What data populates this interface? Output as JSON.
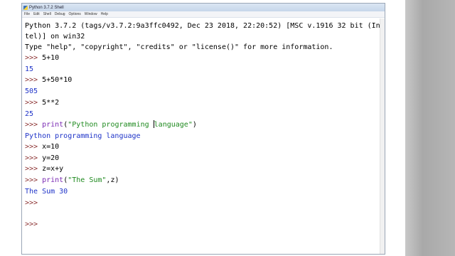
{
  "window": {
    "title": "Python 3.7.2 Shell"
  },
  "menu": [
    "File",
    "Edit",
    "Shell",
    "Debug",
    "Options",
    "Window",
    "Help"
  ],
  "console": {
    "banner1": "Python 3.7.2 (tags/v3.7.2:9a3ffc0492, Dec 23 2018, 22:20:52) [MSC v.1916 32 bit (In",
    "banner2": "tel)] on win32",
    "banner3": "Type \"help\", \"copyright\", \"credits\" or \"license()\" for more information.",
    "prompt": ">>> ",
    "l1_in": "5+10",
    "l1_out": "15",
    "l2_in": "5+50*10",
    "l2_out": "505",
    "l3_in": "5**2",
    "l3_out": "25",
    "l4_kw": "print",
    "l4_open": "(",
    "l4_str_a": "\"Python programming ",
    "l4_str_b": "language\"",
    "l4_close": ")",
    "l4_out": "Python programming language",
    "l5_in": "x=10",
    "l6_in": "y=20",
    "l7_in": "z=x+y",
    "l8_kw": "print",
    "l8_open": "(",
    "l8_str": "\"The Sum\"",
    "l8_rest": ",z)",
    "l8_out": "The Sum 30",
    "p_empty1": ">>>",
    "p_empty2": ">>>"
  }
}
